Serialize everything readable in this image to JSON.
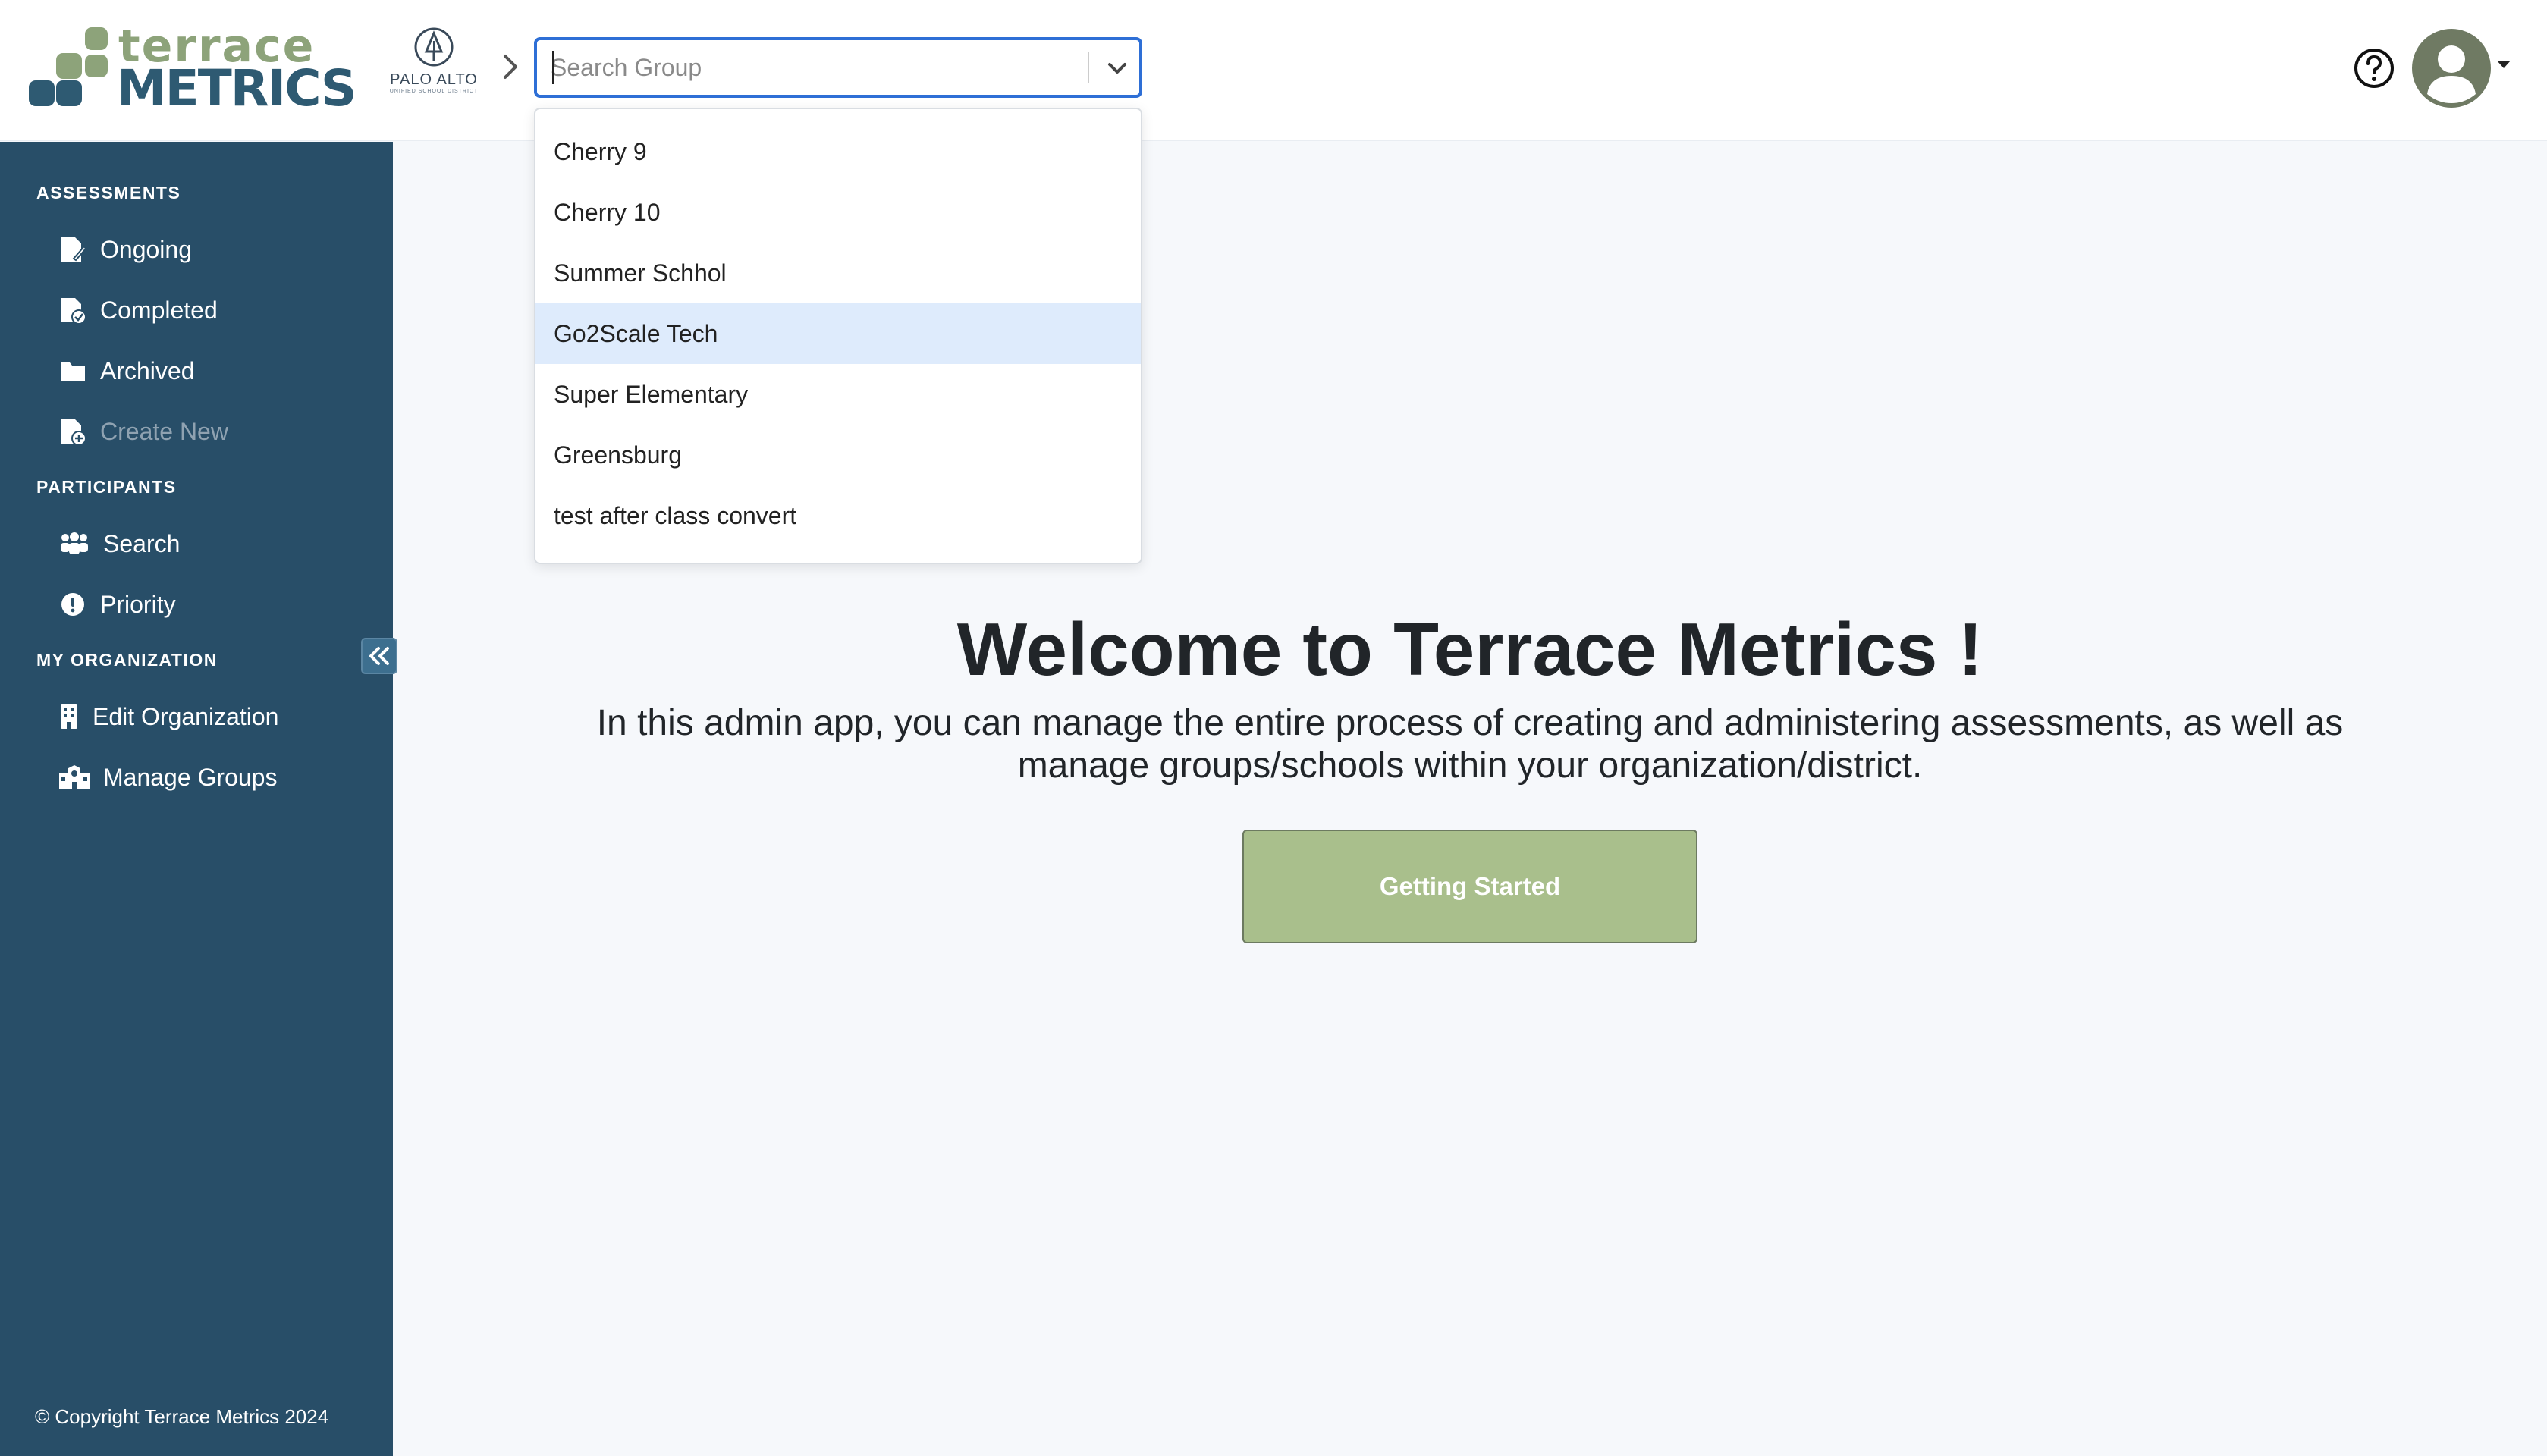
{
  "brand": {
    "line1": "terrace",
    "line2": "METRICS"
  },
  "org": {
    "name": "PALO ALTO",
    "subtitle": "UNIFIED SCHOOL DISTRICT"
  },
  "search": {
    "placeholder": "Search Group",
    "options": [
      "Cherry 9",
      "Cherry 10",
      "Summer Schhol",
      "Go2Scale Tech",
      "Super Elementary",
      "Greensburg",
      "test after class convert"
    ],
    "focused_option": "Go2Scale Tech"
  },
  "sidebar": {
    "sections": [
      {
        "title": "ASSESSMENTS"
      },
      {
        "title": "PARTICIPANTS"
      },
      {
        "title": "MY ORGANIZATION"
      }
    ],
    "items": [
      {
        "label": "Ongoing",
        "icon": "file-edit-icon"
      },
      {
        "label": "Completed",
        "icon": "file-check-icon"
      },
      {
        "label": "Archived",
        "icon": "folder-icon"
      },
      {
        "label": "Create New",
        "icon": "file-plus-icon",
        "disabled": true
      },
      {
        "label": "Search",
        "icon": "people-group-icon"
      },
      {
        "label": "Priority",
        "icon": "exclamation-circle-icon"
      },
      {
        "label": "Edit Organization",
        "icon": "building-icon"
      },
      {
        "label": "Manage Groups",
        "icon": "school-icon"
      }
    ],
    "copyright": "© Copyright Terrace Metrics 2024"
  },
  "main": {
    "title": "Welcome to Terrace Metrics !",
    "description": "In this admin app, you can manage the entire process of creating and administering assessments, as well as manage groups/schools within your organization/district.",
    "cta_label": "Getting Started"
  },
  "colors": {
    "sidebar_bg": "#284e68",
    "accent_green": "#a9bf8c",
    "brand_blue": "#2e5a72",
    "focus_blue": "#2e6fd6",
    "option_focus": "#deebfc"
  }
}
